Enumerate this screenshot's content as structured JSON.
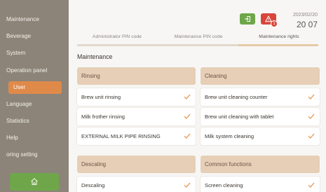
{
  "sidebar": {
    "items": [
      {
        "label": "Maintenance"
      },
      {
        "label": "Beverage"
      },
      {
        "label": "System"
      },
      {
        "label": "Operation panel"
      },
      {
        "label": "User"
      },
      {
        "label": "Language"
      },
      {
        "label": "Statistics"
      },
      {
        "label": "Help"
      },
      {
        "label": "oring setting"
      }
    ],
    "active_index": 4
  },
  "header": {
    "date": "2023/02/20",
    "time": "20 07",
    "alert_count": "1"
  },
  "tabs": [
    {
      "label": "Administrator PIN code"
    },
    {
      "label": "Maintenance PIN code"
    },
    {
      "label": "Maintenance rights"
    }
  ],
  "section_title": "Maintenance",
  "groups": {
    "rinsing": {
      "title": "Rinsing",
      "items": [
        "Brew unit rinsing",
        "Milk frother rinsing",
        "EXTERNAL MILK PIPE RINSING"
      ]
    },
    "cleaning": {
      "title": "Cleaning",
      "items": [
        "Brew unit cleaning counter",
        "Brew unit cleaning with tablet",
        "Milk system cleaning"
      ]
    },
    "descaling": {
      "title": "Descaling",
      "items": [
        "Descaling"
      ]
    },
    "common": {
      "title": "Common functions",
      "items": [
        "Screen cleaning"
      ]
    }
  },
  "icons": {
    "check": "check-icon",
    "home": "home-icon",
    "logout": "logout-icon",
    "alert": "warning-icon"
  },
  "colors": {
    "sidebar": "#8c8478",
    "active": "#e08a4a",
    "green": "#6fa64a",
    "red": "#d9453a",
    "group_header": "#e6cfb6",
    "check": "#e8a060"
  }
}
